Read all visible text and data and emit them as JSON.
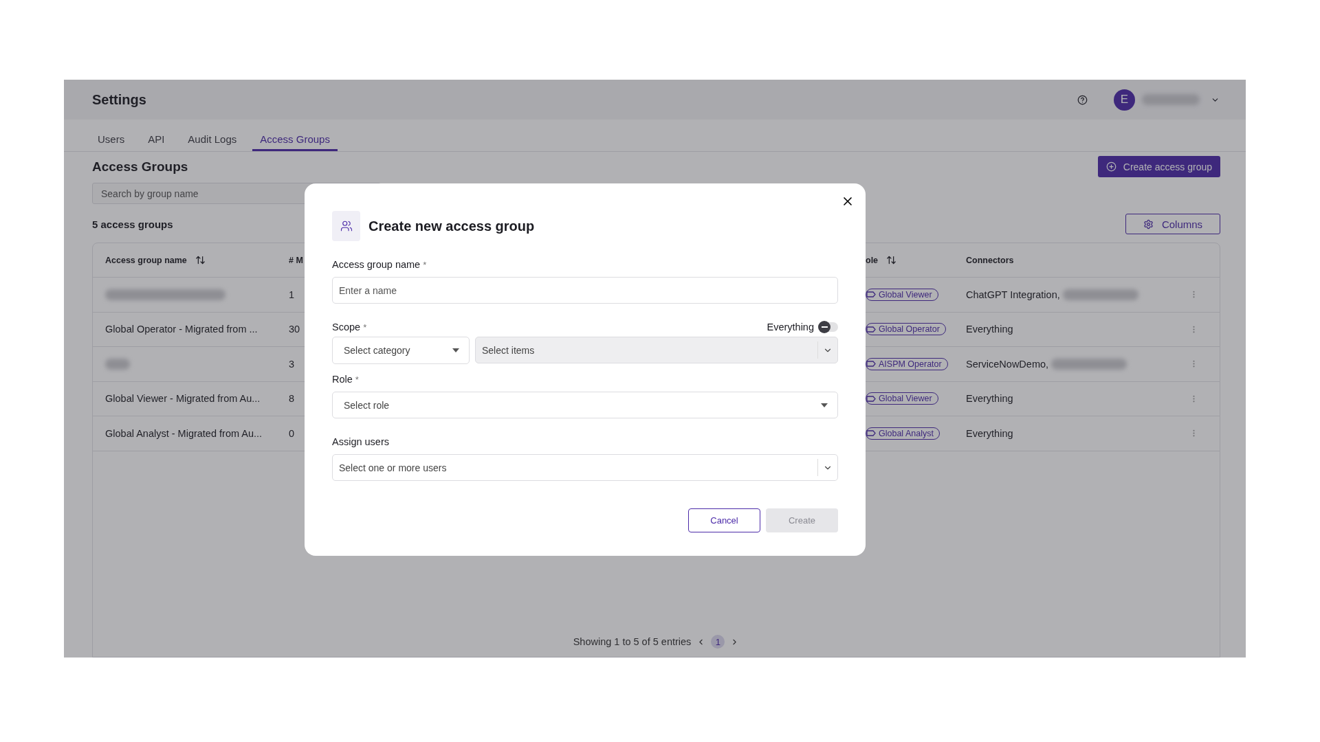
{
  "header": {
    "title": "Settings",
    "user": {
      "avatar": "E",
      "name_redacted": true
    }
  },
  "tabs": [
    {
      "label": "Users",
      "selected": false
    },
    {
      "label": "API",
      "selected": false
    },
    {
      "label": "Audit Logs",
      "selected": false
    },
    {
      "label": "Access Groups",
      "selected": true
    }
  ],
  "page": {
    "title": "Access Groups",
    "create_button": "Create access group",
    "search": {
      "placeholder": "Search by group name"
    },
    "count": "5 access groups",
    "columns_button": "Columns"
  },
  "table": {
    "columns": [
      {
        "label": "Access group name",
        "sortable": true
      },
      {
        "label": "# M",
        "sortable": false
      },
      {
        "label": "ole",
        "sortable": true
      },
      {
        "label": "Connectors",
        "sortable": false
      }
    ],
    "rows": [
      {
        "name_redacted": true,
        "members": "1",
        "role": "Global Viewer",
        "connectors": "ChatGPT Integration,",
        "connectors_redacted": true
      },
      {
        "name": "Global Operator - Migrated from ...",
        "members": "30",
        "role": "Global Operator",
        "connectors": "Everything"
      },
      {
        "name_redacted": true,
        "members": "3",
        "role": "AISPM Operator",
        "connectors": "ServiceNowDemo,",
        "connectors_redacted": true
      },
      {
        "name": "Global Viewer - Migrated from Au...",
        "members": "8",
        "role": "Global Viewer",
        "connectors": "Everything"
      },
      {
        "name": "Global Analyst - Migrated from Au...",
        "members": "0",
        "role": "Global Analyst",
        "connectors": "Everything"
      }
    ]
  },
  "pagination": {
    "summary": "Showing 1 to 5 of 5 entries",
    "pages": [
      {
        "label": "1",
        "selected": true
      }
    ]
  },
  "dialog": {
    "title": "Create new access group",
    "fields": [
      {
        "kind": "text",
        "label": "Access group name",
        "required_mark": "*",
        "placeholder": "Enter a name"
      },
      {
        "kind": "scope",
        "label": "Scope",
        "required_mark": "*",
        "toggle": {
          "label": "Everything",
          "on": false
        },
        "category_placeholder": "Select category",
        "items_placeholder": "Select items"
      },
      {
        "kind": "select",
        "label": "Role",
        "required_mark": "*",
        "placeholder": "Select role"
      },
      {
        "kind": "multiselect",
        "label": "Assign users",
        "placeholder": "Select one or more users"
      }
    ],
    "buttons": [
      {
        "label": "Cancel",
        "kind": "secondary",
        "disabled": false
      },
      {
        "label": "Create",
        "kind": "primary",
        "disabled": true
      }
    ]
  }
}
